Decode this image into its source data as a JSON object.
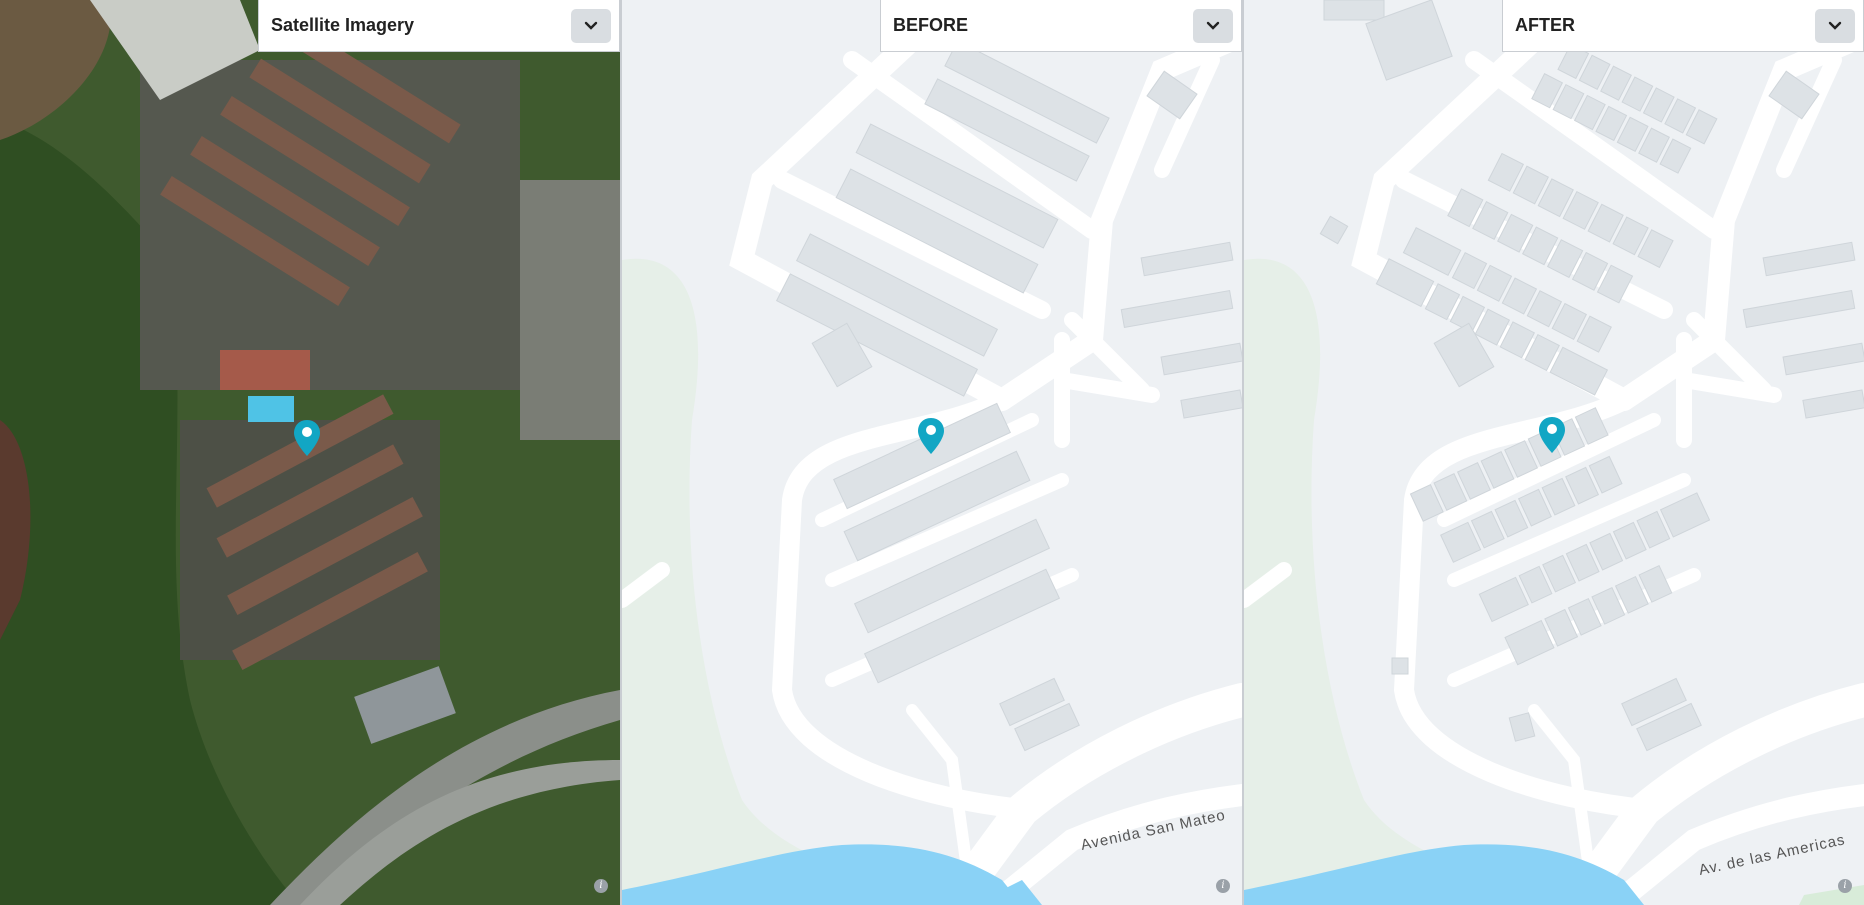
{
  "panels": {
    "left": {
      "title": "Satellite Imagery",
      "info_label": "i"
    },
    "before": {
      "title": "BEFORE",
      "street_label": "Avenida San Mateo",
      "info_label": "i"
    },
    "after": {
      "title": "AFTER",
      "street_label": "Av. de las Americas",
      "info_label": "i"
    }
  },
  "icons": {
    "dropdown": "chevron-down-icon",
    "marker": "map-pin-icon",
    "info": "info-icon"
  },
  "colors": {
    "pin": "#12a6c4",
    "water": "#8ad2f6",
    "map_bg": "#eef1f4",
    "road": "#ffffff",
    "building": "#dde2e6",
    "park": "#e6efe8"
  }
}
